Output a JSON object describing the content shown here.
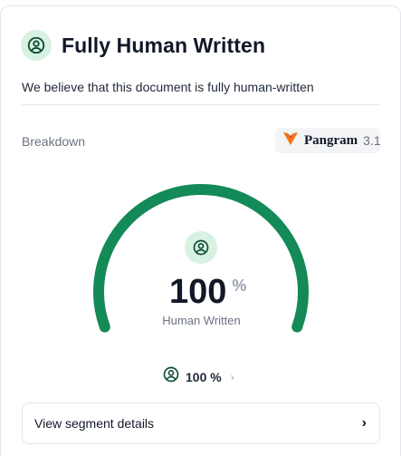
{
  "result": {
    "title": "Fully Human Written",
    "subtitle": "We believe that this document is fully human-written"
  },
  "breakdown": {
    "label": "Breakdown",
    "brand": {
      "name": "Pangram",
      "version": "3.1"
    }
  },
  "gauge": {
    "value": "100",
    "unit": "%",
    "caption": "Human Written",
    "fraction": 1.0,
    "color": "#138a57"
  },
  "summary": {
    "value": "100 %",
    "chevron": "›"
  },
  "segment_button": {
    "label": "View segment details",
    "chevron": "›"
  },
  "icons": {
    "result": "user-circle-icon",
    "gauge": "user-circle-icon",
    "summary": "user-circle-icon",
    "brand": "pangram-logo-icon"
  },
  "colors": {
    "accent": "#138a57",
    "icon_bg": "#d7f1e2",
    "muted": "#6b7280"
  }
}
